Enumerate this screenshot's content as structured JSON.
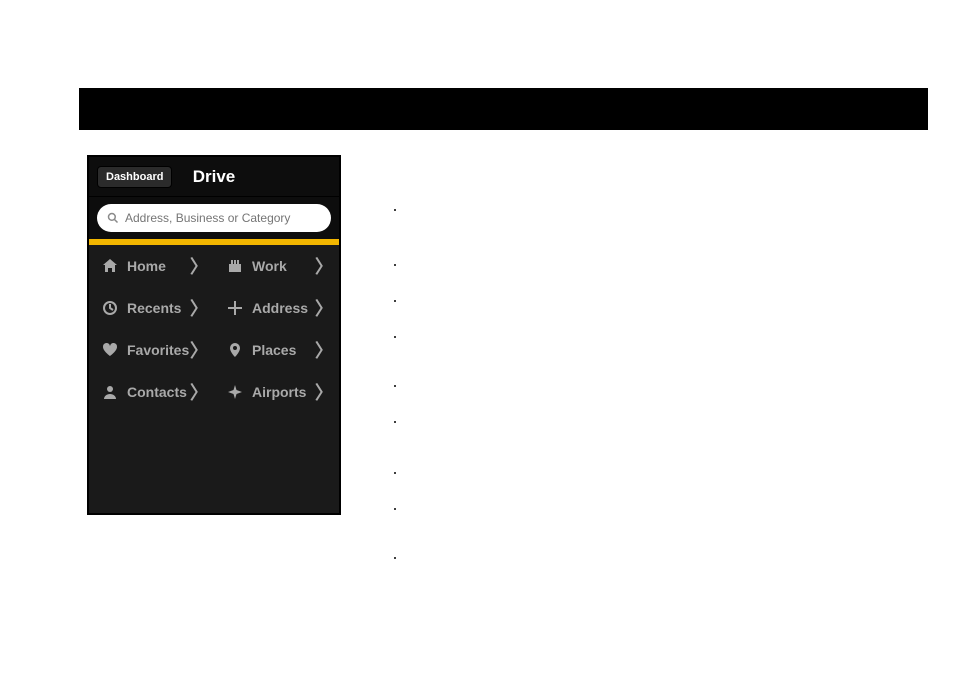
{
  "topbar": {
    "back_label": "Dashboard",
    "title": "Drive"
  },
  "search": {
    "placeholder": "Address, Business or Category"
  },
  "grid": {
    "items": [
      {
        "label": "Home",
        "icon": "home-icon"
      },
      {
        "label": "Work",
        "icon": "work-icon"
      },
      {
        "label": "Recents",
        "icon": "clock-icon"
      },
      {
        "label": "Address",
        "icon": "intersection-icon"
      },
      {
        "label": "Favorites",
        "icon": "heart-icon"
      },
      {
        "label": "Places",
        "icon": "pin-icon"
      },
      {
        "label": "Contacts",
        "icon": "person-icon"
      },
      {
        "label": "Airports",
        "icon": "airplane-icon"
      }
    ]
  },
  "bullets": [
    "",
    "",
    "",
    "",
    "",
    "",
    "",
    "",
    ""
  ]
}
